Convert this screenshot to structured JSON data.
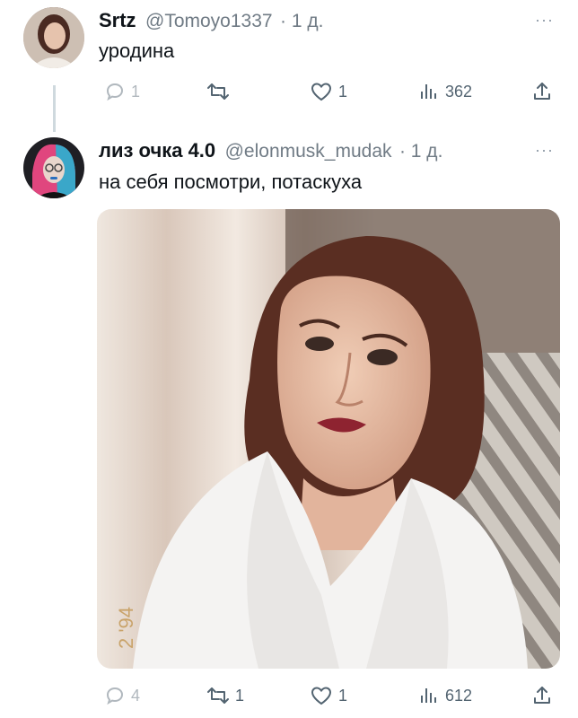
{
  "tweets": [
    {
      "display_name": "Srtz",
      "handle": "@Tomoyo1337",
      "time": "· 1 д.",
      "text": "уродина",
      "replies": "1",
      "retweets": "",
      "likes": "1",
      "views": "362",
      "more": "···"
    },
    {
      "display_name": "лиз очка 4.0",
      "handle": "@elonmusk_mudak",
      "time": "· 1 д.",
      "text": "на себя посмотри, потаскуха",
      "replies": "4",
      "retweets": "1",
      "likes": "1",
      "views": "612",
      "more": "···",
      "photo_stamp": "2 '94"
    }
  ],
  "icons": [
    "reply-icon",
    "retweet-icon",
    "like-icon",
    "views-icon",
    "share-icon"
  ],
  "colors": {
    "text": "#0f1419",
    "muted": "#536471",
    "thread": "#cfd9de"
  }
}
